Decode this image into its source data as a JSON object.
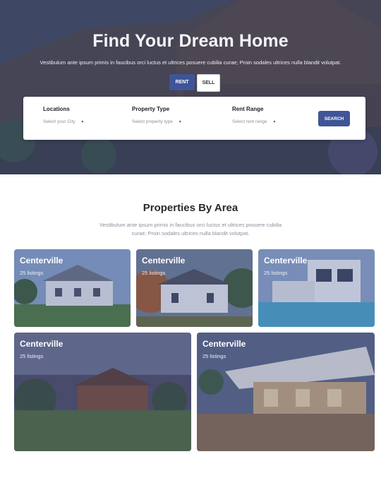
{
  "hero": {
    "title": "Find Your Dream Home",
    "subtitle": "Vestibulum ante ipsum primis in faucibus orci luctus et ultrices posuere cubilia curae; Proin sodales ultrices nulla blandit volutpat.",
    "toggle": {
      "rent_label": "RENT",
      "sell_label": "SELL",
      "active": "RENT"
    }
  },
  "search": {
    "fields": [
      {
        "label": "Locations",
        "placeholder": "Select your City"
      },
      {
        "label": "Property Type",
        "placeholder": "Select property type"
      },
      {
        "label": "Rent Range",
        "placeholder": "Select rent range"
      }
    ],
    "button_label": "SEARCH"
  },
  "section": {
    "title": "Properties By Area",
    "subtitle": "Vestibulum ante ipsum primis in faucibus orci luctus et ultrices posuere cubilia curae; Proin sodales ultrices nulla blandit volutpat."
  },
  "areas": [
    {
      "name": "Centerville",
      "listings": "25 listings"
    },
    {
      "name": "Centerville",
      "listings": "25 listings"
    },
    {
      "name": "Centerville",
      "listings": "25 listings"
    },
    {
      "name": "Centerville",
      "listings": "25 listings"
    },
    {
      "name": "Centerville",
      "listings": "25 listings"
    }
  ],
  "colors": {
    "accent": "#3f5597",
    "text_muted": "#8a8f9a"
  }
}
